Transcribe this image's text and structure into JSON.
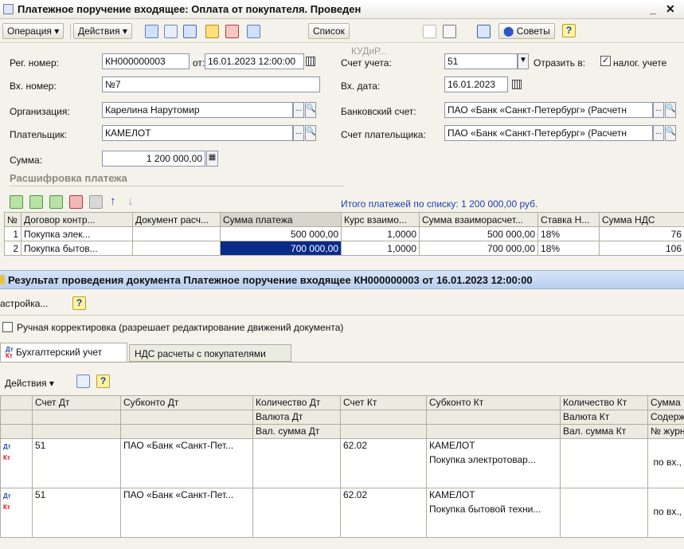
{
  "window": {
    "title": "Платежное поручение входящее: Оплата от покупателя. Проведен",
    "minimize": "_",
    "close": "✕"
  },
  "toolbar": {
    "operation": "Операция ▾",
    "actions": "Действия ▾",
    "list": "Список",
    "kudir": "КУДиР...",
    "tips": "Советы",
    "help": "?"
  },
  "form": {
    "reg_label": "Рег. номер:",
    "reg_value": "КН000000003",
    "from_label": "от:",
    "date_value": "16.01.2023 12:00:00",
    "in_label": "Вх. номер:",
    "in_value": "№7",
    "org_label": "Организация:",
    "org_value": "Карелина Нарутомир",
    "payer_label": "Плательщик:",
    "payer_value": "КАМЕЛОТ",
    "sum_label": "Сумма:",
    "sum_value": "1 200 000,00",
    "account_label": "Счет учета:",
    "account_value": "51",
    "reflect_label": "Отразить в:",
    "reflect_check": "✓",
    "tax_label": "налог. учете",
    "in_date_label": "Вх. дата:",
    "in_date_value": "16.01.2023",
    "bank_label": "Банковский счет:",
    "bank_value": "ПАО «Банк «Санкт-Петербург» (Расчетн",
    "payer_acc_label": "Счет плательщика:",
    "payer_acc_value": "ПАО «Банк «Санкт-Петербург» (Расчетн"
  },
  "payments": {
    "title": "Расшифровка платежа",
    "total": "Итого платежей по списку: 1 200 000,00 руб.",
    "columns": [
      "№",
      "Договор контр...",
      "Документ расч...",
      "Сумма платежа",
      "Курс взаимо...",
      "Сумма взаиморасчет...",
      "Ставка Н...",
      "Сумма НДС"
    ],
    "rows": [
      [
        "1",
        "Покупка элек...",
        "",
        "500 000,00",
        "1,0000",
        "500 000,00",
        "18%",
        "76"
      ],
      [
        "2",
        "Покупка бытов...",
        "",
        "700 000,00",
        "1,0000",
        "700 000,00",
        "18%",
        "106"
      ]
    ]
  },
  "result": {
    "title": "Результат проведения документа Платежное поручение входящее КН000000003 от 16.01.2023 12:00:00",
    "settings": "астройка...",
    "help": "?",
    "manual": "Ручная корректировка (разрешает редактирование движений документа)",
    "tab_accounting": "Бухгалтерский учет",
    "tab_vat": "НДС расчеты с покупателями",
    "actions": "Действия ▾",
    "columns_row1": [
      "",
      "Счет Дт",
      "Субконто Дт",
      "Количество Дт",
      "Счет Кт",
      "Субконто Кт",
      "Количество Кт",
      "Сумма"
    ],
    "columns_row2": [
      "",
      "",
      "",
      "Валюта Дт",
      "",
      "",
      "Валюта Кт",
      "Содерж"
    ],
    "columns_row3": [
      "",
      "",
      "",
      "Вал. сумма Дт",
      "",
      "",
      "Вал. сумма Кт",
      "№ журн"
    ],
    "entries": [
      {
        "debit": "51",
        "subconto_dt": "ПАО «Банк «Санкт-Пет...",
        "credit": "62.02",
        "subconto_kt1": "КАМЕЛОТ",
        "subconto_kt2": "Покупка  электротовар...",
        "content": "по вх.,"
      },
      {
        "debit": "51",
        "subconto_dt": "ПАО «Банк «Санкт-Пет...",
        "credit": "62.02",
        "subconto_kt1": "КАМЕЛОТ",
        "subconto_kt2": "Покупка бытовой техни...",
        "content": "по вх.,"
      }
    ],
    "dt": "Дт",
    "kt": "Кт"
  }
}
